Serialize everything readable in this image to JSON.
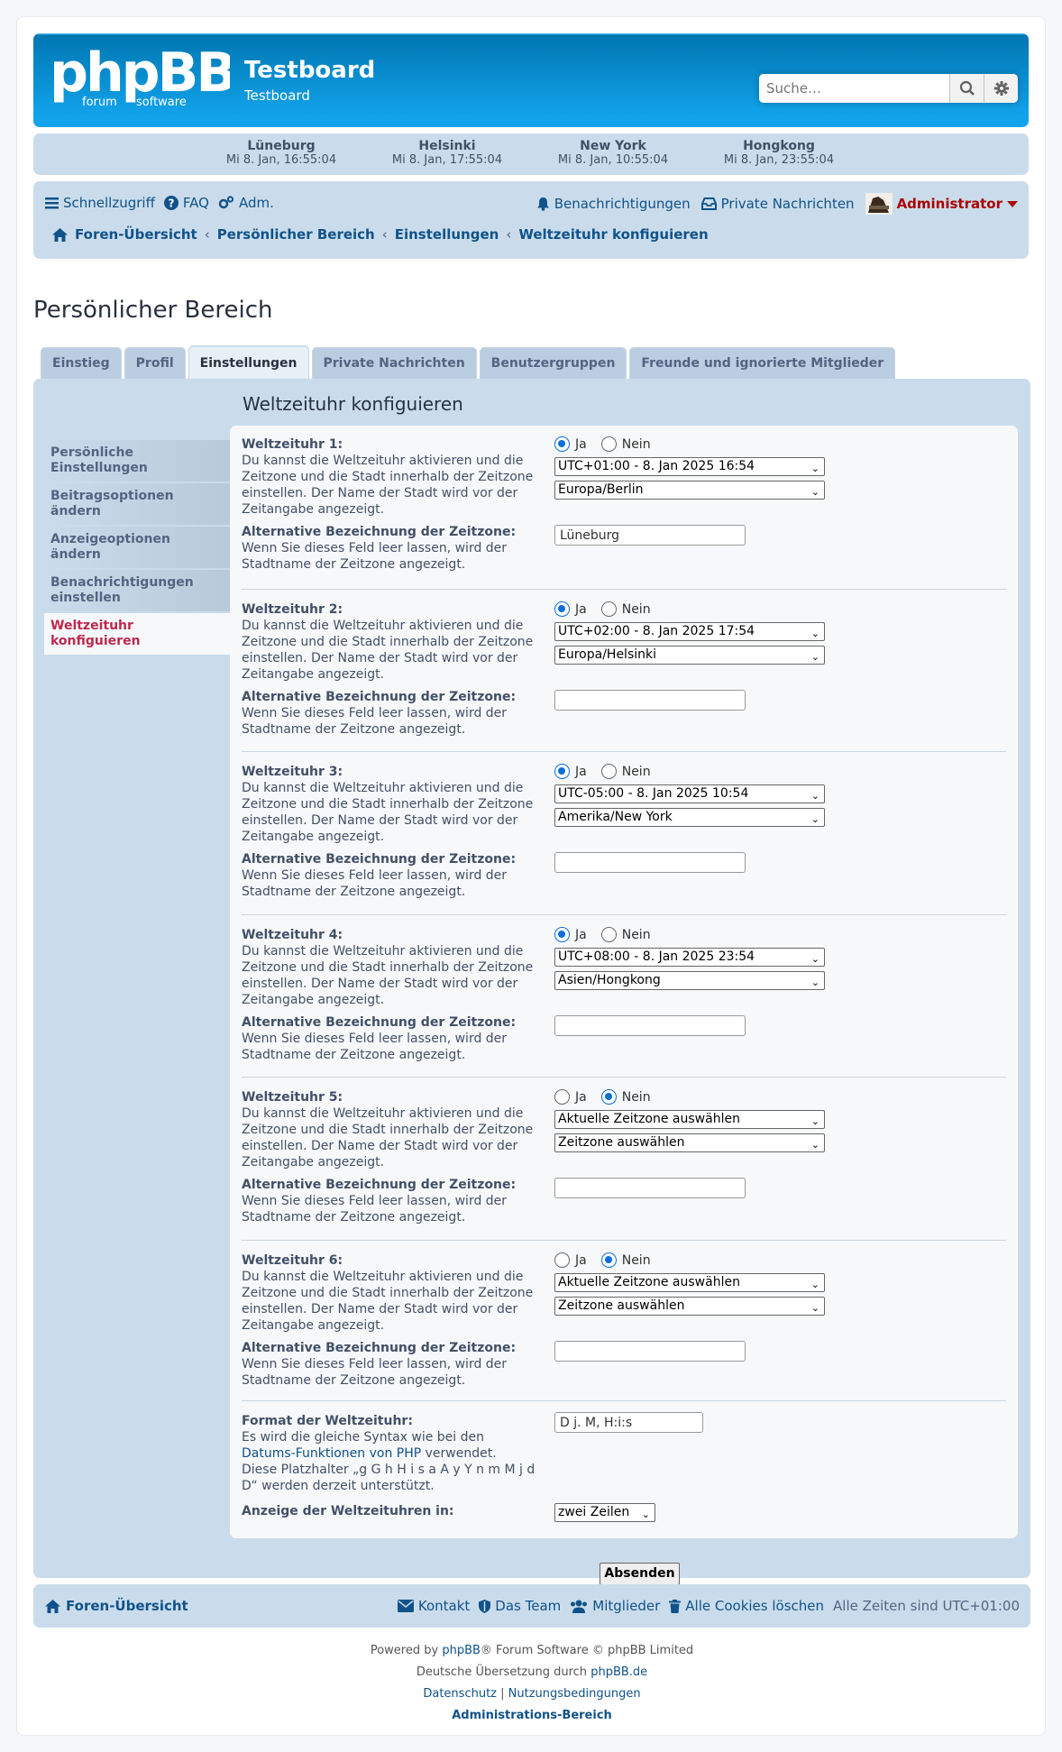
{
  "header": {
    "site_title": "Testboard",
    "site_desc": "Testboard",
    "search_placeholder": "Suche…",
    "logo_text": "phpBB",
    "logo_sub1": "forum",
    "logo_sub2": "software"
  },
  "clocks": [
    {
      "city": "Lüneburg",
      "time": "Mi 8. Jan, 16:55:04"
    },
    {
      "city": "Helsinki",
      "time": "Mi 8. Jan, 17:55:04"
    },
    {
      "city": "New York",
      "time": "Mi 8. Jan, 10:55:04"
    },
    {
      "city": "Hongkong",
      "time": "Mi 8. Jan, 23:55:04"
    }
  ],
  "nav": {
    "quicklinks": "Schnellzugriff",
    "faq": "FAQ",
    "acp": "Adm.",
    "notifications": "Benachrichtigungen",
    "pm": "Private Nachrichten",
    "username": "Administrator",
    "crumbs": [
      "Foren-Übersicht",
      "Persönlicher Bereich",
      "Einstellungen",
      "Weltzeituhr konfiguieren"
    ]
  },
  "page_title": "Persönlicher Bereich",
  "tabs": [
    "Einstieg",
    "Profil",
    "Einstellungen",
    "Private Nachrichten",
    "Benutzergruppen",
    "Freunde und ignorierte Mitglieder"
  ],
  "panel_title": "Weltzeituhr konfiguieren",
  "side_menu": [
    "Persönliche Einstellungen",
    "Beitragsoptionen ändern",
    "Anzeigeoptionen ändern",
    "Benachrichtigungen einstellen",
    "Weltzeituhr konfiguieren"
  ],
  "labels": {
    "yes": "Ja",
    "no": "Nein",
    "clock_desc": "Du kannst die Weltzeituhr aktivieren und die Zeitzone und die Stadt innerhalb der Zeitzone einstellen. Der Name der Stadt wird vor der Zeitangabe angezeigt.",
    "alt_name": "Alternative Bezeichnung der Zeitzone:",
    "alt_desc": "Wenn Sie dieses Feld leer lassen, wird der Stadtname der Zeitzone angezeigt."
  },
  "world_clocks": [
    {
      "title": "Weltzeituhr 1:",
      "enabled": "yes",
      "offset": "UTC+01:00 - 8. Jan 2025 16:54",
      "zone": "Europa/Berlin",
      "alt": "Lüneburg"
    },
    {
      "title": "Weltzeituhr 2:",
      "enabled": "yes",
      "offset": "UTC+02:00 - 8. Jan 2025 17:54",
      "zone": "Europa/Helsinki",
      "alt": ""
    },
    {
      "title": "Weltzeituhr 3:",
      "enabled": "yes",
      "offset": "UTC-05:00 - 8. Jan 2025 10:54",
      "zone": "Amerika/New York",
      "alt": ""
    },
    {
      "title": "Weltzeituhr 4:",
      "enabled": "yes",
      "offset": "UTC+08:00 - 8. Jan 2025 23:54",
      "zone": "Asien/Hongkong",
      "alt": ""
    },
    {
      "title": "Weltzeituhr 5:",
      "enabled": "no",
      "offset": "Aktuelle Zeitzone auswählen",
      "zone": "Zeitzone auswählen",
      "alt": ""
    },
    {
      "title": "Weltzeituhr 6:",
      "enabled": "no",
      "offset": "Aktuelle Zeitzone auswählen",
      "zone": "Zeitzone auswählen",
      "alt": ""
    }
  ],
  "format": {
    "title": "Format der Weltzeituhr:",
    "desc1": "Es wird die gleiche Syntax wie bei den",
    "link": "Datums-Funktionen von PHP",
    "desc2": "verwendet.",
    "desc3": "Diese Platzhalter „g G h H i s a A y Y n m M j d D“ werden derzeit unterstützt.",
    "value": "D j. M, H:i:s",
    "display_label": "Anzeige der Weltzeituhren in:",
    "display_value": "zwei Zeilen"
  },
  "submit": "Absenden",
  "footer": {
    "index": "Foren-Übersicht",
    "contact": "Kontakt",
    "team": "Das Team",
    "members": "Mitglieder",
    "cookies": "Alle Cookies löschen",
    "timezone": "Alle Zeiten sind UTC+01:00"
  },
  "copyright": {
    "powered_pre": "Powered by",
    "phpbb": "phpBB",
    "powered_post": "® Forum Software © phpBB Limited",
    "translation_pre": "Deutsche Übersetzung durch",
    "translation_link": "phpBB.de",
    "privacy": "Datenschutz",
    "sep": "|",
    "terms": "Nutzungsbedingungen",
    "acp": "Administrations-Bereich"
  },
  "colors": {
    "brand_blue": "#12a3eb",
    "panel_bg": "#cadceb",
    "link": "#105289",
    "active_menu": "#bc2a4d",
    "admin_red": "#aa0000"
  }
}
